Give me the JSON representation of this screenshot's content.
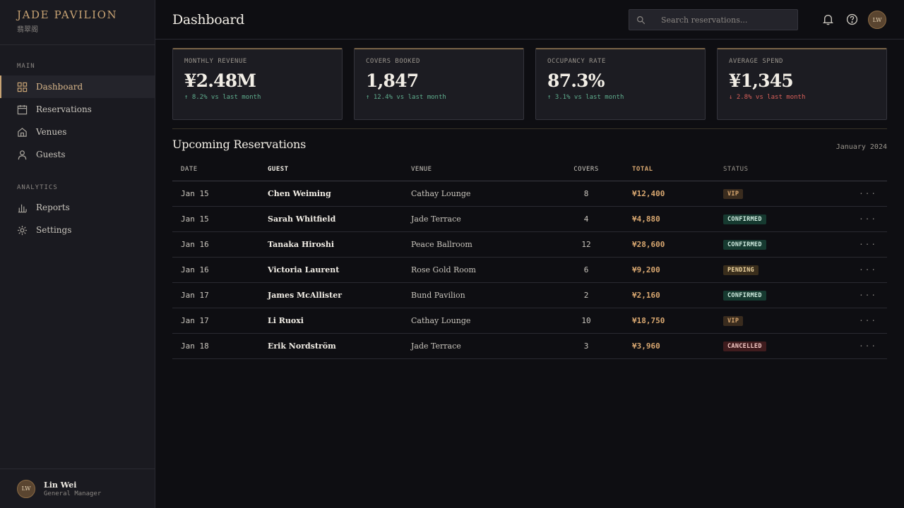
{
  "brand": {
    "name": "JADE PAVILION",
    "subtitle": "翡翠阁"
  },
  "sidebar": {
    "sections": [
      {
        "label": "MAIN",
        "items": [
          {
            "label": "Dashboard",
            "icon": "grid-icon",
            "active": true
          },
          {
            "label": "Reservations",
            "icon": "calendar-icon"
          },
          {
            "label": "Venues",
            "icon": "home-icon"
          },
          {
            "label": "Guests",
            "icon": "user-icon"
          }
        ]
      },
      {
        "label": "ANALYTICS",
        "items": [
          {
            "label": "Reports",
            "icon": "bar-chart-icon"
          },
          {
            "label": "Settings",
            "icon": "gear-icon"
          }
        ]
      }
    ],
    "user": {
      "initials": "LW",
      "name": "Lin Wei",
      "role": "General Manager"
    }
  },
  "header": {
    "title": "Dashboard",
    "search_placeholder": "Search reservations...",
    "avatar_initials": "LW"
  },
  "stats": [
    {
      "label": "MONTHLY REVENUE",
      "value": "¥2.48M",
      "delta": "↑ 8.2% vs last month",
      "trend": "up"
    },
    {
      "label": "COVERS BOOKED",
      "value": "1,847",
      "delta": "↑ 12.4% vs last month",
      "trend": "up"
    },
    {
      "label": "OCCUPANCY RATE",
      "value": "87.3%",
      "delta": "↑ 3.1% vs last month",
      "trend": "up"
    },
    {
      "label": "AVERAGE SPEND",
      "value": "¥1,345",
      "delta": "↓ 2.8% vs last month",
      "trend": "down"
    }
  ],
  "reservations": {
    "title": "Upcoming Reservations",
    "period": "January 2024",
    "columns": [
      "DATE",
      "GUEST",
      "VENUE",
      "COVERS",
      "TOTAL",
      "STATUS"
    ],
    "rows": [
      {
        "date": "Jan 15",
        "guest": "Chen Weiming",
        "venue": "Cathay Lounge",
        "covers": "8",
        "total": "¥12,400",
        "status": "VIP"
      },
      {
        "date": "Jan 15",
        "guest": "Sarah Whitfield",
        "venue": "Jade Terrace",
        "covers": "4",
        "total": "¥4,880",
        "status": "CONFIRMED"
      },
      {
        "date": "Jan 16",
        "guest": "Tanaka Hiroshi",
        "venue": "Peace Ballroom",
        "covers": "12",
        "total": "¥28,600",
        "status": "CONFIRMED"
      },
      {
        "date": "Jan 16",
        "guest": "Victoria Laurent",
        "venue": "Rose Gold Room",
        "covers": "6",
        "total": "¥9,200",
        "status": "PENDING"
      },
      {
        "date": "Jan 17",
        "guest": "James McAllister",
        "venue": "Bund Pavilion",
        "covers": "2",
        "total": "¥2,160",
        "status": "CONFIRMED"
      },
      {
        "date": "Jan 17",
        "guest": "Li Ruoxi",
        "venue": "Cathay Lounge",
        "covers": "10",
        "total": "¥18,750",
        "status": "VIP"
      },
      {
        "date": "Jan 18",
        "guest": "Erik Nordström",
        "venue": "Jade Terrace",
        "covers": "3",
        "total": "¥3,960",
        "status": "CANCELLED"
      }
    ],
    "row_action": "···"
  },
  "colors": {
    "accent": "#c8a374",
    "positive": "#5fae8e",
    "negative": "#d9605a",
    "background": "#0e0e12"
  }
}
